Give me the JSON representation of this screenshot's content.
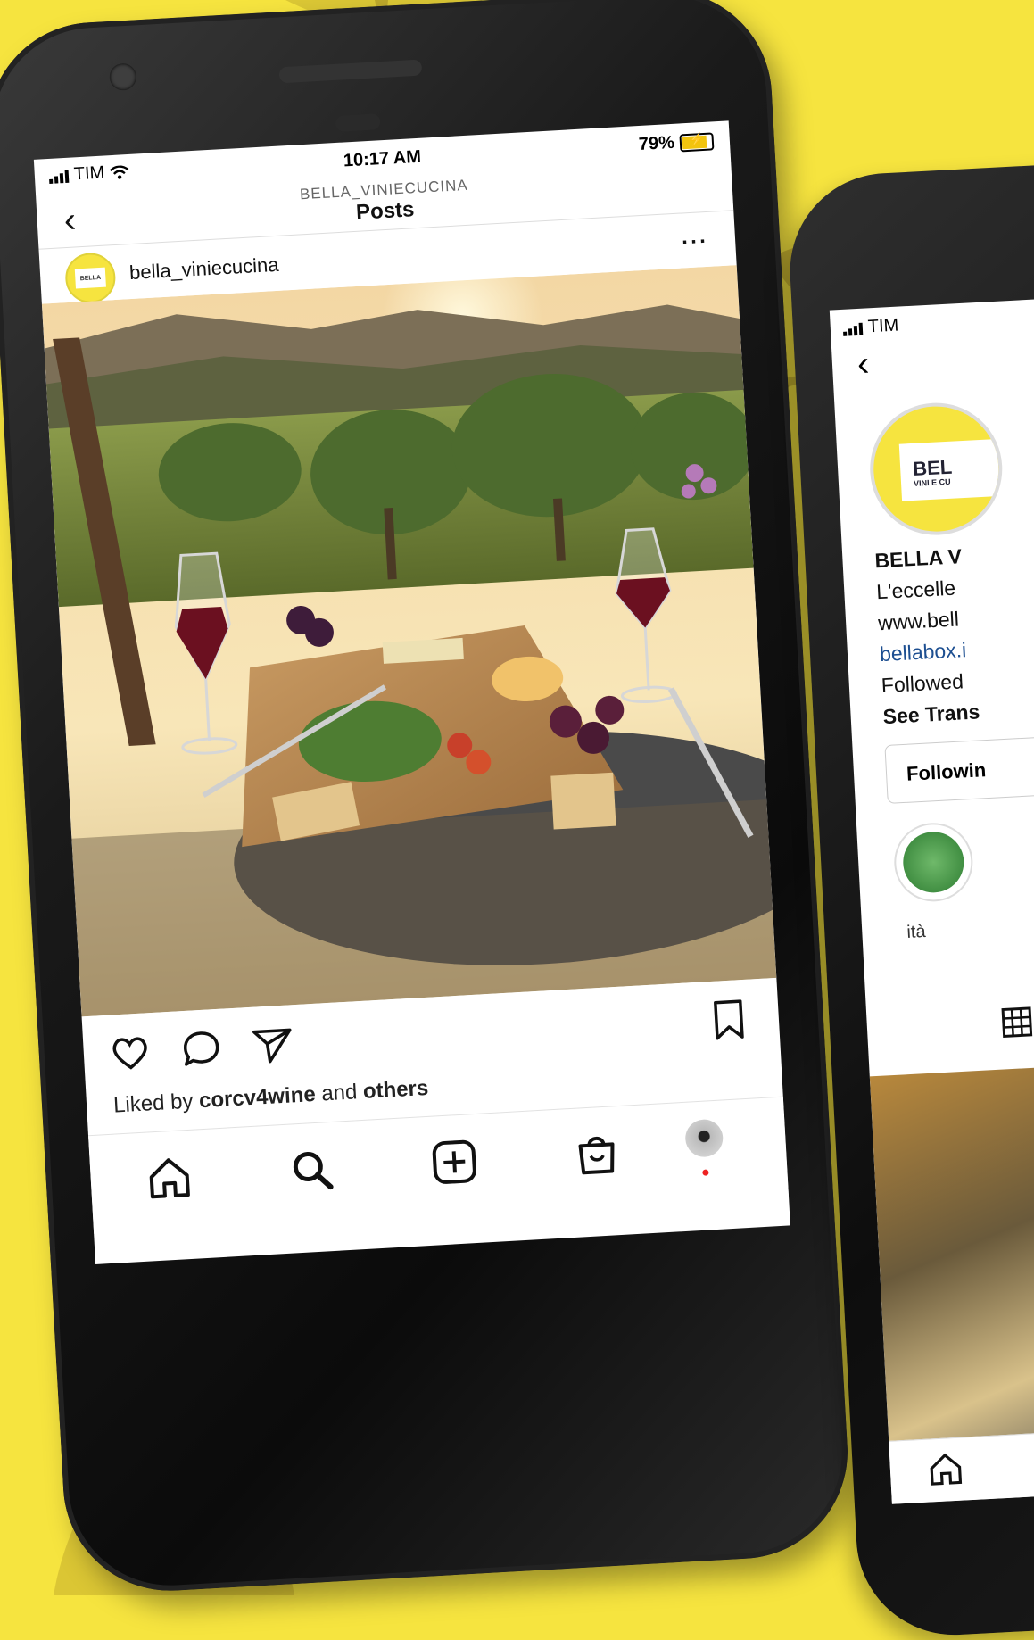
{
  "colors": {
    "background": "#f6e43f",
    "phone": "#0f0f0f",
    "notification_dot": "#e22222",
    "link": "#1d4f91"
  },
  "main_phone": {
    "status_bar": {
      "carrier": "TIM",
      "time": "10:17 AM",
      "battery": "79%"
    },
    "header": {
      "subtitle": "BELLA_VINIECUCINA",
      "title": "Posts",
      "back_icon": "chevron-left-icon"
    },
    "post": {
      "username": "bella_viniecucina",
      "avatar_text": "BELLA",
      "more_icon": "ellipsis-icon",
      "image_subject": "sunset vineyard, charcuterie board, red wine glasses",
      "actions": [
        "heart-icon",
        "comment-icon",
        "share-icon",
        "bookmark-icon"
      ],
      "liked_by_prefix": "Liked by ",
      "liked_by_user": "corcv4wine",
      "liked_by_suffix": " and ",
      "liked_by_others": "others"
    },
    "bottom_nav": [
      "home-icon",
      "search-icon",
      "new-post-icon",
      "shop-icon",
      "profile-avatar"
    ]
  },
  "second_phone": {
    "status_bar": {
      "carrier": "TIM"
    },
    "avatar_text": "BEL",
    "avatar_sub": "VINI E CU",
    "lines": {
      "name": "BELLA V",
      "bio": "L'eccelle",
      "website": "www.bell",
      "link": "bellabox.i",
      "followed": "Followed",
      "translate": "See Trans"
    },
    "follow_button": "Followin",
    "highlight_label": "ità"
  }
}
